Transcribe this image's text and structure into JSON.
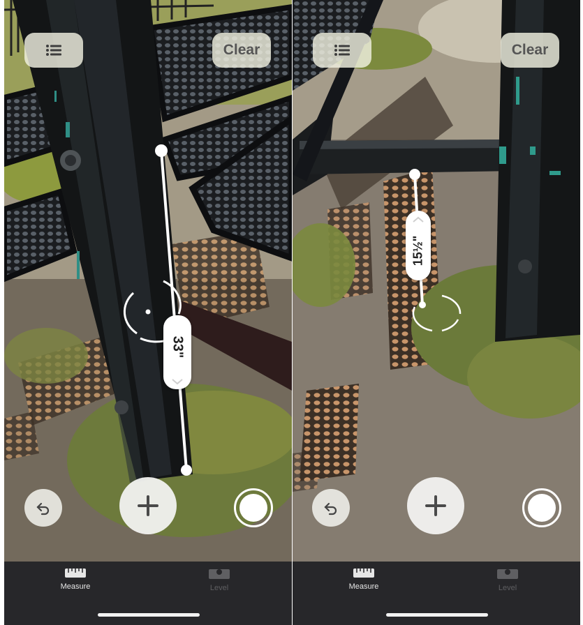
{
  "screens": [
    {
      "name": "left",
      "list_icon": "list-icon",
      "clear_label": "Clear",
      "measurement_label": "33\"",
      "chevron_icon": "chevron-down-icon",
      "reticle_icon": "reticle-icon",
      "undo_icon": "undo-icon",
      "add_icon": "plus-icon",
      "shutter_icon": "shutter-icon",
      "tabs": [
        {
          "label": "Measure",
          "icon": "ruler-icon",
          "active": true
        },
        {
          "label": "Level",
          "icon": "level-icon",
          "active": false
        }
      ]
    },
    {
      "name": "right",
      "list_icon": "list-icon",
      "clear_label": "Clear",
      "measurement_label": "15½\"",
      "chevron_icon": "chevron-up-icon",
      "reticle_icon": "reticle-icon",
      "undo_icon": "undo-icon",
      "add_icon": "plus-icon",
      "shutter_icon": "shutter-icon",
      "tabs": [
        {
          "label": "Measure",
          "icon": "ruler-icon",
          "active": true
        },
        {
          "label": "Level",
          "icon": "level-icon",
          "active": false
        }
      ]
    }
  ],
  "colors": {
    "tabbar_bg": "#27272a",
    "active_tab": "#e6e6e6",
    "inactive_tab": "#5f5f62",
    "button_bg": "#f0f0e1",
    "measure_line": "#ffffff"
  }
}
